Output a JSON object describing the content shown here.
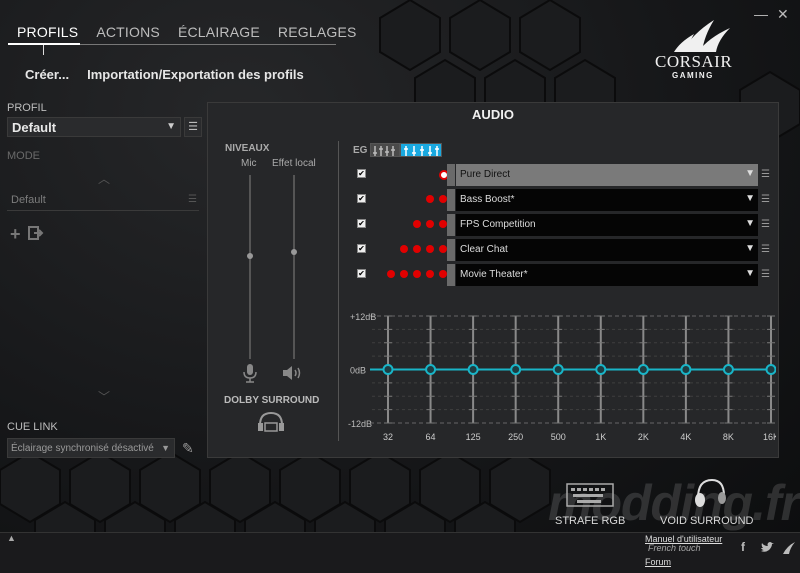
{
  "nav": {
    "tabs": [
      "PROFILS",
      "ACTIONS",
      "ÉCLAIRAGE",
      "REGLAGES"
    ],
    "active": 0,
    "sub": [
      "Créer...",
      "Importation/Exportation des profils"
    ]
  },
  "window": {
    "minimize": "—",
    "close": "✕"
  },
  "brand": {
    "name": "CORSAIR",
    "tagline": "GAMING"
  },
  "left": {
    "profile_label": "PROFIL",
    "profile_value": "Default",
    "mode_label": "MODE",
    "mode_item": "Default",
    "cuelink_label": "CUE LINK",
    "cuelink_value": "Éclairage synchronisé désactivé"
  },
  "audio": {
    "title": "AUDIO",
    "levels_label": "NIVEAUX",
    "mic_label": "Mic",
    "local_label": "Effet local",
    "mic_level": 0.56,
    "local_level": 0.58,
    "dolby_label": "DOLBY SURROUND",
    "eq_label": "EG",
    "presets": [
      {
        "name": "Pure Direct",
        "dots": 1,
        "active": true
      },
      {
        "name": "Bass Boost*",
        "dots": 2,
        "active": false
      },
      {
        "name": "FPS Competition",
        "dots": 3,
        "active": false
      },
      {
        "name": "Clear Chat",
        "dots": 4,
        "active": false
      },
      {
        "name": "Movie Theater*",
        "dots": 5,
        "active": false
      }
    ],
    "eq": {
      "top_label": "+12dB",
      "mid_label": "0dB",
      "bottom_label": "-12dB",
      "bands": [
        "32",
        "64",
        "125",
        "250",
        "500",
        "1K",
        "2K",
        "4K",
        "8K",
        "16K"
      ],
      "gains": [
        0,
        0,
        0,
        0,
        0,
        0,
        0,
        0,
        0,
        0
      ],
      "range": [
        -12,
        12
      ],
      "accent": "#19b5c8"
    }
  },
  "devices": {
    "keyboard": "STRAFE RGB",
    "headset": "VOID SURROUND"
  },
  "footer": {
    "manual": "Manuel d'utilisateur",
    "forum": "Forum",
    "watermark": "modding.fr",
    "version_hint": "French touch"
  },
  "colors": {
    "preset_dot": "#e10000",
    "eq_accent": "#19b5c8"
  }
}
